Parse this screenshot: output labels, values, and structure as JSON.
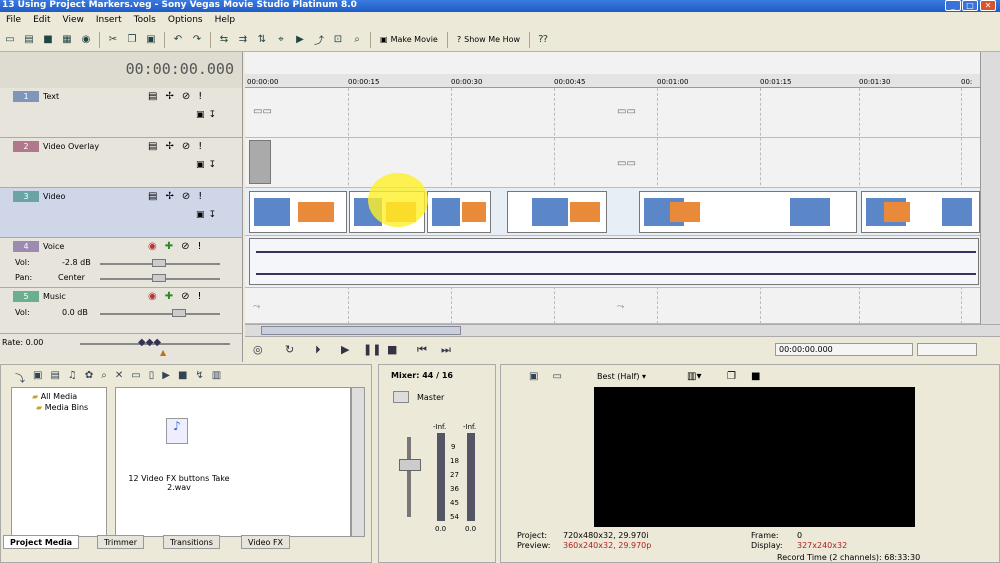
{
  "window": {
    "title": "13 Using Project Markers.veg - Sony Vegas Movie Studio Platinum 8.0"
  },
  "menu": [
    "File",
    "Edit",
    "View",
    "Insert",
    "Tools",
    "Options",
    "Help"
  ],
  "toolbar": {
    "make_movie": "Make Movie",
    "show_me_how": "Show Me How"
  },
  "timecode": "00:00:00.000",
  "tracks": [
    {
      "num": "1",
      "name": "Text",
      "color": "#7f96b8"
    },
    {
      "num": "2",
      "name": "Video Overlay",
      "color": "#b0788a"
    },
    {
      "num": "3",
      "name": "Video",
      "color": "#6aa4a4"
    },
    {
      "num": "4",
      "name": "Voice",
      "color": "#9c8ab0",
      "vol_label": "Vol:",
      "vol": "-2.8 dB",
      "pan_label": "Pan:",
      "pan": "Center"
    },
    {
      "num": "5",
      "name": "Music",
      "color": "#6ab090",
      "vol_label": "Vol:",
      "vol": "0.0 dB"
    }
  ],
  "ruler": [
    "00:00:00",
    "00:00:15",
    "00:00:30",
    "00:00:45",
    "00:01:00",
    "00:01:15",
    "00:01:30",
    "00:"
  ],
  "rate": "Rate: 0.00",
  "transport_time": "00:00:00.000",
  "media": {
    "tree": [
      "All Media",
      "Media Bins"
    ],
    "file": "12 Video FX buttons Take 2.wav",
    "tabs": [
      "Project Media",
      "Trimmer",
      "Transitions",
      "Video FX"
    ]
  },
  "mixer": {
    "title": "Mixer: 44 / 16",
    "master": "Master",
    "inf": "-Inf.",
    "scale": [
      "9",
      "18",
      "27",
      "36",
      "45",
      "54"
    ],
    "bottom": "0.0"
  },
  "preview": {
    "quality": "Best (Half)",
    "project_label": "Project:",
    "project": "720x480x32, 29.970i",
    "preview_label": "Preview:",
    "preview": "360x240x32, 29.970p",
    "frame_label": "Frame:",
    "frame": "0",
    "display_label": "Display:",
    "display": "327x240x32",
    "record": "Record Time (2 channels): 68:33:30"
  }
}
